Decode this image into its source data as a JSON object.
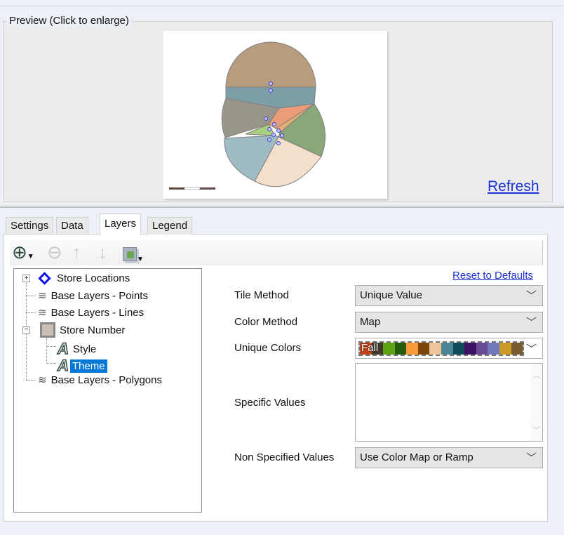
{
  "preview": {
    "title": "Preview (Click to enlarge)",
    "refresh_label": "Refresh"
  },
  "tabs": [
    {
      "label": "Settings"
    },
    {
      "label": "Data"
    },
    {
      "label": "Layers",
      "active": true
    },
    {
      "label": "Legend"
    }
  ],
  "toolbar": {
    "icons": [
      "add-layer-icon",
      "remove-layer-icon",
      "move-up-icon",
      "move-down-icon",
      "layer-group-icon"
    ]
  },
  "tree": {
    "items": [
      {
        "label": "Store Locations",
        "icon": "diamond-icon"
      },
      {
        "label": "Base Layers - Points",
        "icon": "layers-icon"
      },
      {
        "label": "Base Layers - Lines",
        "icon": "layers-icon"
      },
      {
        "label": "Store Number",
        "icon": "polygon-swatch-icon"
      },
      {
        "label": "Style",
        "icon": "label-a-icon"
      },
      {
        "label": "Theme",
        "icon": "label-a-icon",
        "selected": true
      },
      {
        "label": "Base Layers - Polygons",
        "icon": "layers-icon"
      }
    ]
  },
  "props": {
    "reset_label": "Reset to Defaults",
    "tile_method": {
      "label": "Tile Method",
      "value": "Unique Value"
    },
    "color_method": {
      "label": "Color Method",
      "value": "Map"
    },
    "unique_colors": {
      "label": "Unique Colors",
      "value": "Fall",
      "swatches": [
        "#c0431a",
        "#3f3a2c",
        "#5ea314",
        "#245c0c",
        "#f79a37",
        "#7a4609",
        "#eec49a",
        "#4a8593",
        "#0f4a58",
        "#3b1563",
        "#6a4a92",
        "#7276bb",
        "#c99a2a",
        "#775a2c"
      ]
    },
    "specific_values": {
      "label": "Specific Values",
      "value": ""
    },
    "non_specified": {
      "label": "Non Specified Values",
      "value": "Use Color Map or Ramp"
    }
  },
  "colors": {
    "selection": "#0078d7",
    "link": "#1a33d6"
  }
}
